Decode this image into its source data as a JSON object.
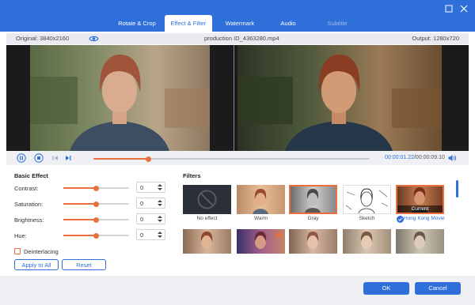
{
  "tabs": [
    {
      "label": "Rotate & Crop",
      "state": "normal"
    },
    {
      "label": "Effect & Filter",
      "state": "active"
    },
    {
      "label": "Watermark",
      "state": "normal"
    },
    {
      "label": "Audio",
      "state": "normal"
    },
    {
      "label": "Subtitle",
      "state": "disabled"
    }
  ],
  "info": {
    "original": "Original: 3840x2160",
    "filename": "production ID_4363280.mp4",
    "output": "Output: 1280x720"
  },
  "player": {
    "current": "00:00:01.22",
    "duration": "/00:00:09.10",
    "progress": 0.2
  },
  "basic": {
    "title": "Basic Effect",
    "rows": [
      {
        "label": "Contrast:",
        "value": "0",
        "level": 0.5
      },
      {
        "label": "Saturation:",
        "value": "0",
        "level": 0.5
      },
      {
        "label": "Brightness:",
        "value": "0",
        "level": 0.5
      },
      {
        "label": "Hue:",
        "value": "0",
        "level": 0.5
      }
    ],
    "deinterlacing": "Deinterlacing",
    "apply_all": "Apply to All",
    "reset": "Reset"
  },
  "filters": {
    "title": "Filters",
    "row1": [
      "No effect",
      "Warm",
      "Gray",
      "Sketch",
      "Hong Kong Movie"
    ],
    "current_badge": "Current"
  },
  "footer": {
    "ok": "OK",
    "cancel": "Cancel"
  },
  "colors": {
    "accent": "#2f6fd9",
    "orange": "#e9703e"
  }
}
